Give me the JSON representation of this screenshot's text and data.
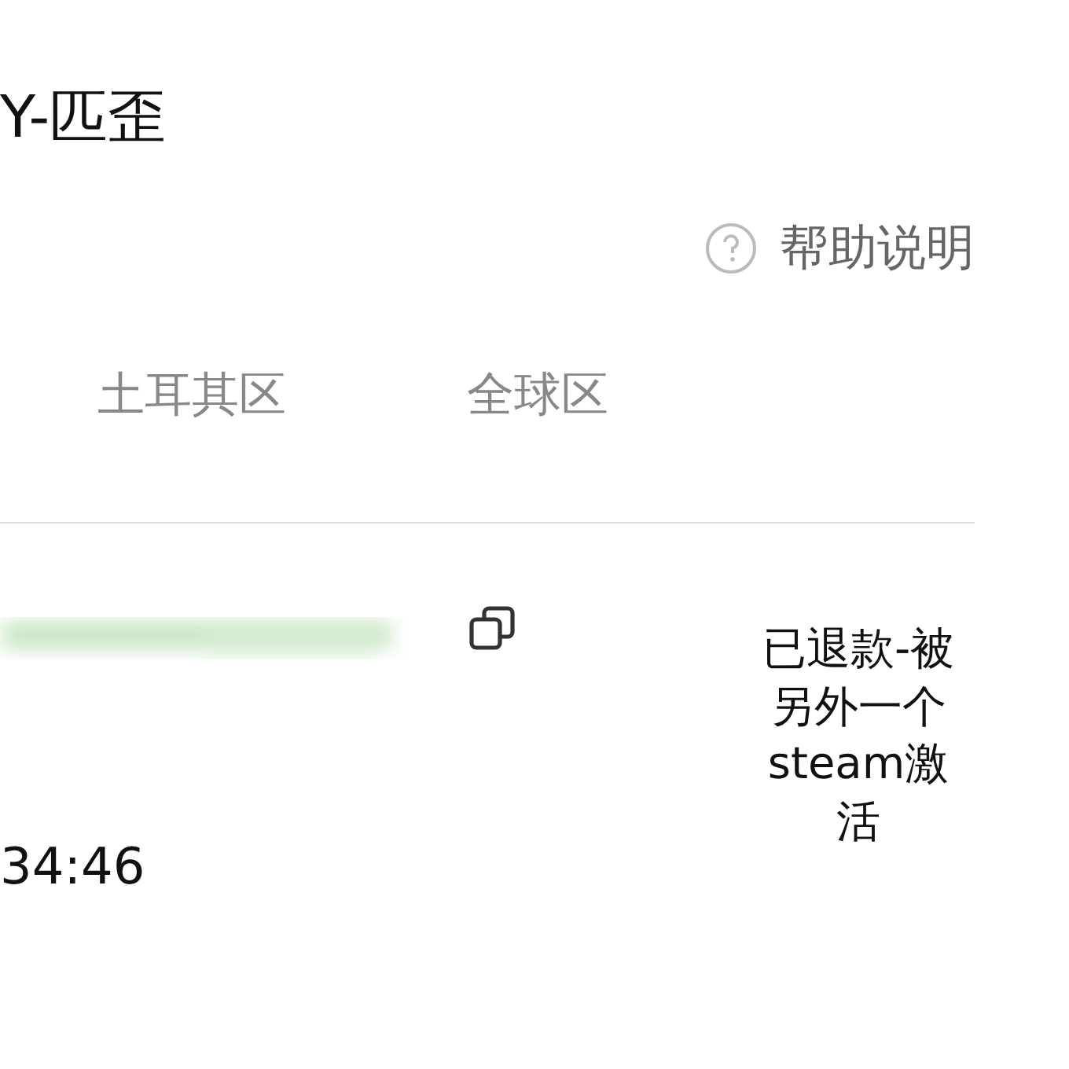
{
  "header": {
    "title": "Y-匹歪"
  },
  "help": {
    "label": "帮助说明"
  },
  "tabs": [
    {
      "label": "土耳其区",
      "selected": false
    },
    {
      "label": "全球区",
      "selected": false
    }
  ],
  "order": {
    "time": "34:46",
    "status": "已退款-被另外一个steam激活"
  }
}
